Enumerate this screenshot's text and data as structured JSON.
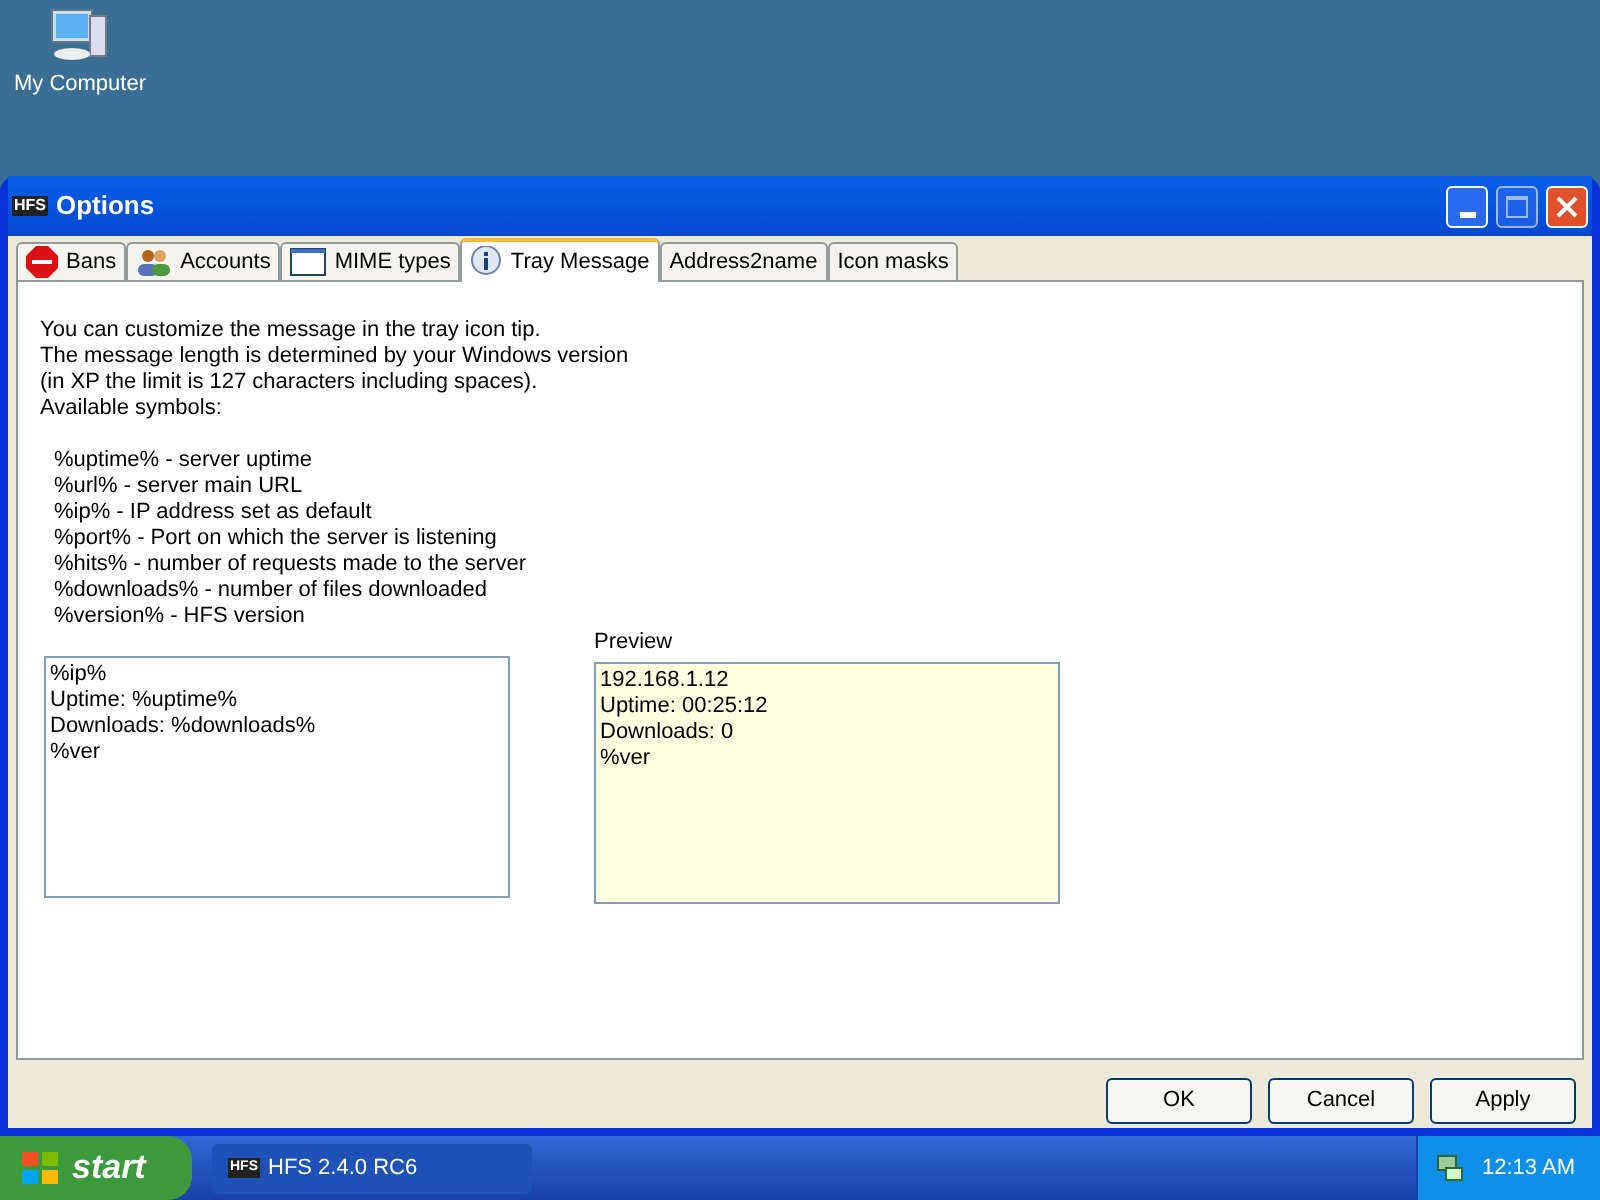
{
  "desktop": {
    "icons": [
      {
        "label": "My Computer"
      }
    ]
  },
  "window": {
    "title": "Options",
    "app_badge": "HFS"
  },
  "tabs": [
    {
      "label": "Bans",
      "kind": "stop",
      "selected": false
    },
    {
      "label": "Accounts",
      "kind": "users",
      "selected": false
    },
    {
      "label": "MIME types",
      "kind": "window",
      "selected": false
    },
    {
      "label": "Tray Message",
      "kind": "info",
      "selected": true
    },
    {
      "label": "Address2name",
      "kind": "none",
      "selected": false
    },
    {
      "label": "Icon masks",
      "kind": "none",
      "selected": false
    }
  ],
  "intro": [
    "You can customize the message in the tray icon tip.",
    "The message length is determined by your Windows version",
    "(in XP the limit is 127 characters including spaces).",
    "Available symbols:"
  ],
  "symbols": [
    "%uptime% - server uptime",
    "%url% - server main URL",
    "%ip% - IP address set as default",
    "%port% - Port on which the server is listening",
    "%hits% - number of requests made to the server",
    "%downloads% - number of files downloaded",
    "%version% - HFS version"
  ],
  "editor": {
    "value": "%ip%\nUptime: %uptime%\nDownloads: %downloads%\n%ver"
  },
  "preview": {
    "label": "Preview",
    "lines": [
      "192.168.1.12",
      "Uptime: 00:25:12",
      "Downloads: 0",
      "%ver"
    ]
  },
  "buttons": [
    "OK",
    "Cancel",
    "Apply"
  ],
  "taskbar": {
    "start": "start",
    "tasks": [
      {
        "badge": "HFS",
        "label": "HFS 2.4.0 RC6"
      }
    ],
    "clock": "12:13 AM"
  }
}
